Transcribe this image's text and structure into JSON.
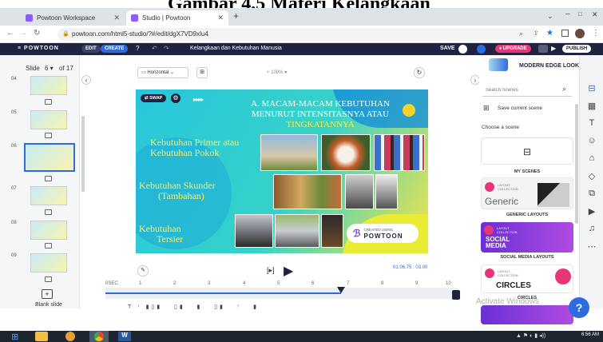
{
  "caption": "Gambar 4.5 Materi Kelangkaan",
  "browser": {
    "tabs": [
      {
        "title": "Powtoon Workspace",
        "active": false
      },
      {
        "title": "Studio | Powtoon",
        "active": true
      }
    ],
    "url": "powtoon.com/html5-studio/?#/edit/dgX7VD9xlu4"
  },
  "toolbar": {
    "logo": "≡ POWTOON",
    "edit": "EDIT",
    "create": "CREATE",
    "title": "Kelangkaan dan Kebutuhan Manusia",
    "save": "SAVE",
    "upgrade": "UPGRADE",
    "publish": "PUBLISH"
  },
  "slides_panel": {
    "header_slide": "Slide",
    "current": "6 ▾",
    "of": "of 17",
    "numbers": [
      "04",
      "05",
      "06",
      "07",
      "08",
      "09"
    ],
    "blank_label": "Blank slide"
  },
  "canvas": {
    "orientation": "Horizontal",
    "zoom": "100%",
    "swap": "SWAP",
    "time": "01:06.75 : 03.00",
    "watermark_line1": "CREATED USING",
    "watermark_line2": "POWTOON"
  },
  "slide_content": {
    "title_line1": "A. MACAM-MACAM KEBUTUHAN",
    "title_line2": "MENURUT INTENSITASNYA ATAU",
    "title_line3": "TINGKATANNYA",
    "primer_line1": "Kebutuhan Primer atau",
    "primer_line2": "Kebutuhan Pokok",
    "sekunder_line1": "Kebutuhan Skunder",
    "sekunder_line2": "(Tambahan)",
    "tersier_line1": "Kebutuhan",
    "tersier_line2": "Tersier"
  },
  "right_panel": {
    "style_name": "MODERN EDGE LOOK",
    "search_placeholder": "Search Scenes",
    "save_scene": "Save current scene",
    "choose": "Choose a scene",
    "my_scenes": "MY SCENES",
    "generic_title": "Generic",
    "generic_label": "GENERIC LAYOUTS",
    "social_title": "SOCIAL MEDIA",
    "social_label": "SOCIAL MEDIA LAYOUTS",
    "circles_title": "CIRCLES",
    "circles_label": "CIRCLES",
    "layout_collection": "LAYOUT COLLECTION",
    "activate": "Activate Windows"
  },
  "timeline": {
    "ticks": [
      "0SEC",
      "1",
      "2",
      "3",
      "4",
      "5",
      "6",
      "7",
      "8",
      "9",
      "10"
    ],
    "progress": 0.67
  },
  "taskbar": {
    "clock": "6:56 AM"
  },
  "colors": {
    "toolbar_bg": "#1f2340",
    "brand_blue": "#2d6cdf",
    "upgrade_pink": "#e8357a",
    "slide_yellow_text": "#f8f06b"
  }
}
